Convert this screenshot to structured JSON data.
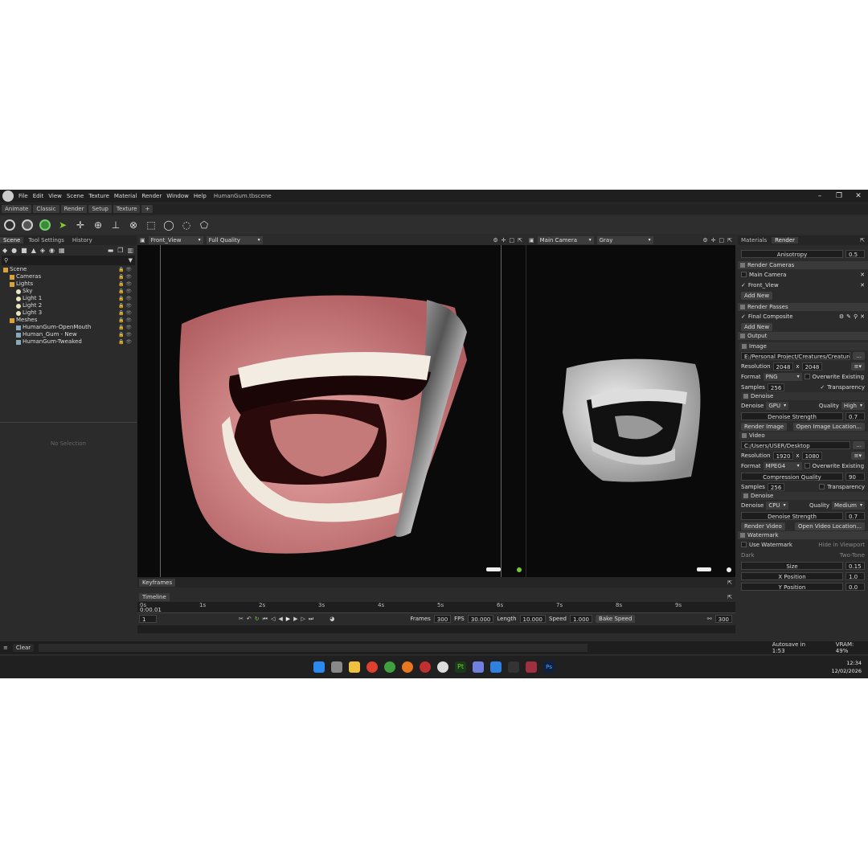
{
  "app": {
    "title": "HumanGum.tbscene",
    "menu": [
      "File",
      "Edit",
      "View",
      "Scene",
      "Texture",
      "Material",
      "Render",
      "Window",
      "Help"
    ]
  },
  "modes": [
    "Animate",
    "Classic",
    "Render",
    "Setup",
    "Texture",
    "+"
  ],
  "left_tabs": [
    "Scene",
    "Tool Settings",
    "History"
  ],
  "tree": [
    {
      "label": "Scene",
      "indent": 0,
      "type": "scene"
    },
    {
      "label": "Cameras",
      "indent": 1,
      "type": "folder"
    },
    {
      "label": "Lights",
      "indent": 1,
      "type": "folder"
    },
    {
      "label": "Sky",
      "indent": 2,
      "type": "light"
    },
    {
      "label": "Light 1",
      "indent": 2,
      "type": "light"
    },
    {
      "label": "Light 2",
      "indent": 2,
      "type": "light"
    },
    {
      "label": "Light 3",
      "indent": 2,
      "type": "light"
    },
    {
      "label": "Meshes",
      "indent": 1,
      "type": "folder"
    },
    {
      "label": "HumanGum-OpenMouth",
      "indent": 2,
      "type": "mesh"
    },
    {
      "label": "Human_Gum - New",
      "indent": 2,
      "type": "mesh"
    },
    {
      "label": "HumanGum-Tweaked",
      "indent": 2,
      "type": "mesh"
    }
  ],
  "no_selection": "No Selection",
  "viewport1": {
    "camera": "Front_View",
    "quality": "Full Quality"
  },
  "viewport2": {
    "camera": "Main Camera",
    "shading": "Gray"
  },
  "bottom": {
    "keyframes_tab": "Keyframes",
    "timeline_tab": "Timeline",
    "ticks": [
      "0s",
      "1s",
      "2s",
      "3s",
      "4s",
      "5s",
      "6s",
      "7s",
      "8s",
      "9s"
    ],
    "current_time": "0:00.01",
    "frame": "1",
    "frames_label": "Frames",
    "frames": "300",
    "fps_label": "FPS",
    "fps": "30.000",
    "length_label": "Length",
    "length": "10.000",
    "speed_label": "Speed",
    "speed": "1.000",
    "bake": "Bake Speed",
    "end_frame": "300"
  },
  "right_tabs": [
    "Materials",
    "Render"
  ],
  "render": {
    "anisotropy_label": "Anisotropy",
    "anisotropy": "0.5",
    "cameras_title": "Render Cameras",
    "cameras": [
      "Main Camera",
      "Front_View"
    ],
    "add_new": "Add New",
    "passes_title": "Render Passes",
    "pass": "Final Composite",
    "output_title": "Output",
    "image_title": "Image",
    "image_path": "E:/Personal Project/Creatures/Creature Pa",
    "resolution_label": "Resolution",
    "img_w": "2048",
    "img_h": "2048",
    "format_label": "Format",
    "img_format": "PNG",
    "overwrite": "Overwrite Existing",
    "samples_label": "Samples",
    "img_samples": "256",
    "transparency": "Transparency",
    "denoise_title": "Denoise",
    "denoise_label": "Denoise",
    "img_dev": "GPU",
    "quality_label": "Quality",
    "img_quality": "High",
    "strength_label": "Denoise Strength",
    "img_strength": "0.7",
    "render_image": "Render Image",
    "open_image": "Open Image Location...",
    "video_title": "Video",
    "video_path": "C:/Users/USER/Desktop",
    "vid_w": "1920",
    "vid_h": "1080",
    "vid_format": "MPEG4",
    "compression_label": "Compression Quality",
    "compression": "90",
    "vid_samples": "256",
    "vid_dev": "CPU",
    "vid_quality": "Medium",
    "vid_strength": "0.7",
    "render_video": "Render Video",
    "open_video": "Open Video Location...",
    "watermark_title": "Watermark",
    "use_watermark": "Use Watermark",
    "hide_viewport": "Hide in Viewport",
    "dark": "Dark",
    "two_tone": "Two-Tone",
    "size_label": "Size",
    "size": "0.15",
    "xpos_label": "X Position",
    "xpos": "1.0",
    "ypos_label": "Y Position",
    "ypos": "0.0"
  },
  "status": {
    "clear": "Clear",
    "autosave": "Autosave in 1:53",
    "vram": "VRAM: 49%"
  },
  "clock": {
    "time": "12:34",
    "date": "12/02/2026"
  }
}
